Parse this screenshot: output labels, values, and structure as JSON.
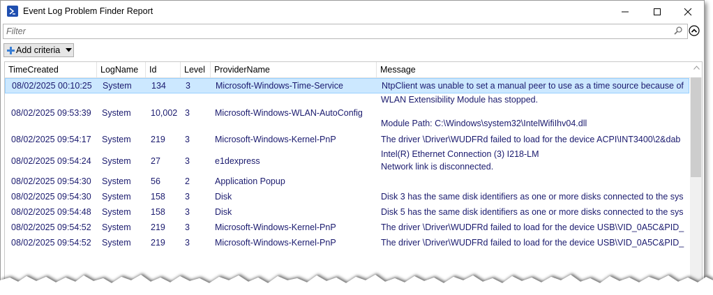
{
  "window": {
    "title": "Event Log Problem Finder Report",
    "icon": "powershell-icon",
    "controls": [
      "minimize-icon",
      "maximize-icon",
      "close-icon"
    ]
  },
  "filter": {
    "placeholder": "Filter",
    "value": ""
  },
  "toolbar": {
    "add_criteria_label": "Add criteria"
  },
  "columns": [
    "TimeCreated",
    "LogName",
    "Id",
    "Level",
    "ProviderName",
    "Message"
  ],
  "rows": [
    {
      "time": "08/02/2025 00:10:25",
      "log": "System",
      "id": "134",
      "level": "3",
      "provider": "Microsoft-Windows-Time-Service",
      "message": [
        "NtpClient was unable to set a manual peer to use as a time source because of"
      ],
      "selected": true
    },
    {
      "time": "08/02/2025 09:53:39",
      "log": "System",
      "id": "10,002",
      "level": "3",
      "provider": "Microsoft-Windows-WLAN-AutoConfig",
      "message": [
        "WLAN Extensibility Module has stopped.",
        "",
        "Module Path: C:\\Windows\\system32\\IntelWifiIhv04.dll"
      ],
      "selected": false
    },
    {
      "time": "08/02/2025 09:54:17",
      "log": "System",
      "id": "219",
      "level": "3",
      "provider": "Microsoft-Windows-Kernel-PnP",
      "message": [
        "The driver \\Driver\\WUDFRd failed to load for the device ACPI\\INT3400\\2&dab"
      ],
      "selected": false
    },
    {
      "time": "08/02/2025 09:54:24",
      "log": "System",
      "id": "27",
      "level": "3",
      "provider": "e1dexpress",
      "message": [
        "Intel(R) Ethernet Connection (3) I218-LM",
        " Network link is disconnected."
      ],
      "selected": false
    },
    {
      "time": "08/02/2025 09:54:30",
      "log": "System",
      "id": "56",
      "level": "2",
      "provider": "Application Popup",
      "message": [
        ""
      ],
      "selected": false
    },
    {
      "time": "08/02/2025 09:54:30",
      "log": "System",
      "id": "158",
      "level": "3",
      "provider": "Disk",
      "message": [
        "Disk 3 has the same disk identifiers as one or more disks connected to the sys"
      ],
      "selected": false
    },
    {
      "time": "08/02/2025 09:54:48",
      "log": "System",
      "id": "158",
      "level": "3",
      "provider": "Disk",
      "message": [
        "Disk 5 has the same disk identifiers as one or more disks connected to the sys"
      ],
      "selected": false
    },
    {
      "time": "08/02/2025 09:54:52",
      "log": "System",
      "id": "219",
      "level": "3",
      "provider": "Microsoft-Windows-Kernel-PnP",
      "message": [
        "The driver \\Driver\\WUDFRd failed to load for the device USB\\VID_0A5C&PID_"
      ],
      "selected": false
    },
    {
      "time": "08/02/2025 09:54:52",
      "log": "System",
      "id": "219",
      "level": "3",
      "provider": "Microsoft-Windows-Kernel-PnP",
      "message": [
        "The driver \\Driver\\WUDFRd failed to load for the device USB\\VID_0A5C&PID_"
      ],
      "selected": false
    }
  ],
  "colors": {
    "selection": "#cce8ff",
    "text": "#1a1a6e",
    "accent": "#1f4fb0"
  }
}
